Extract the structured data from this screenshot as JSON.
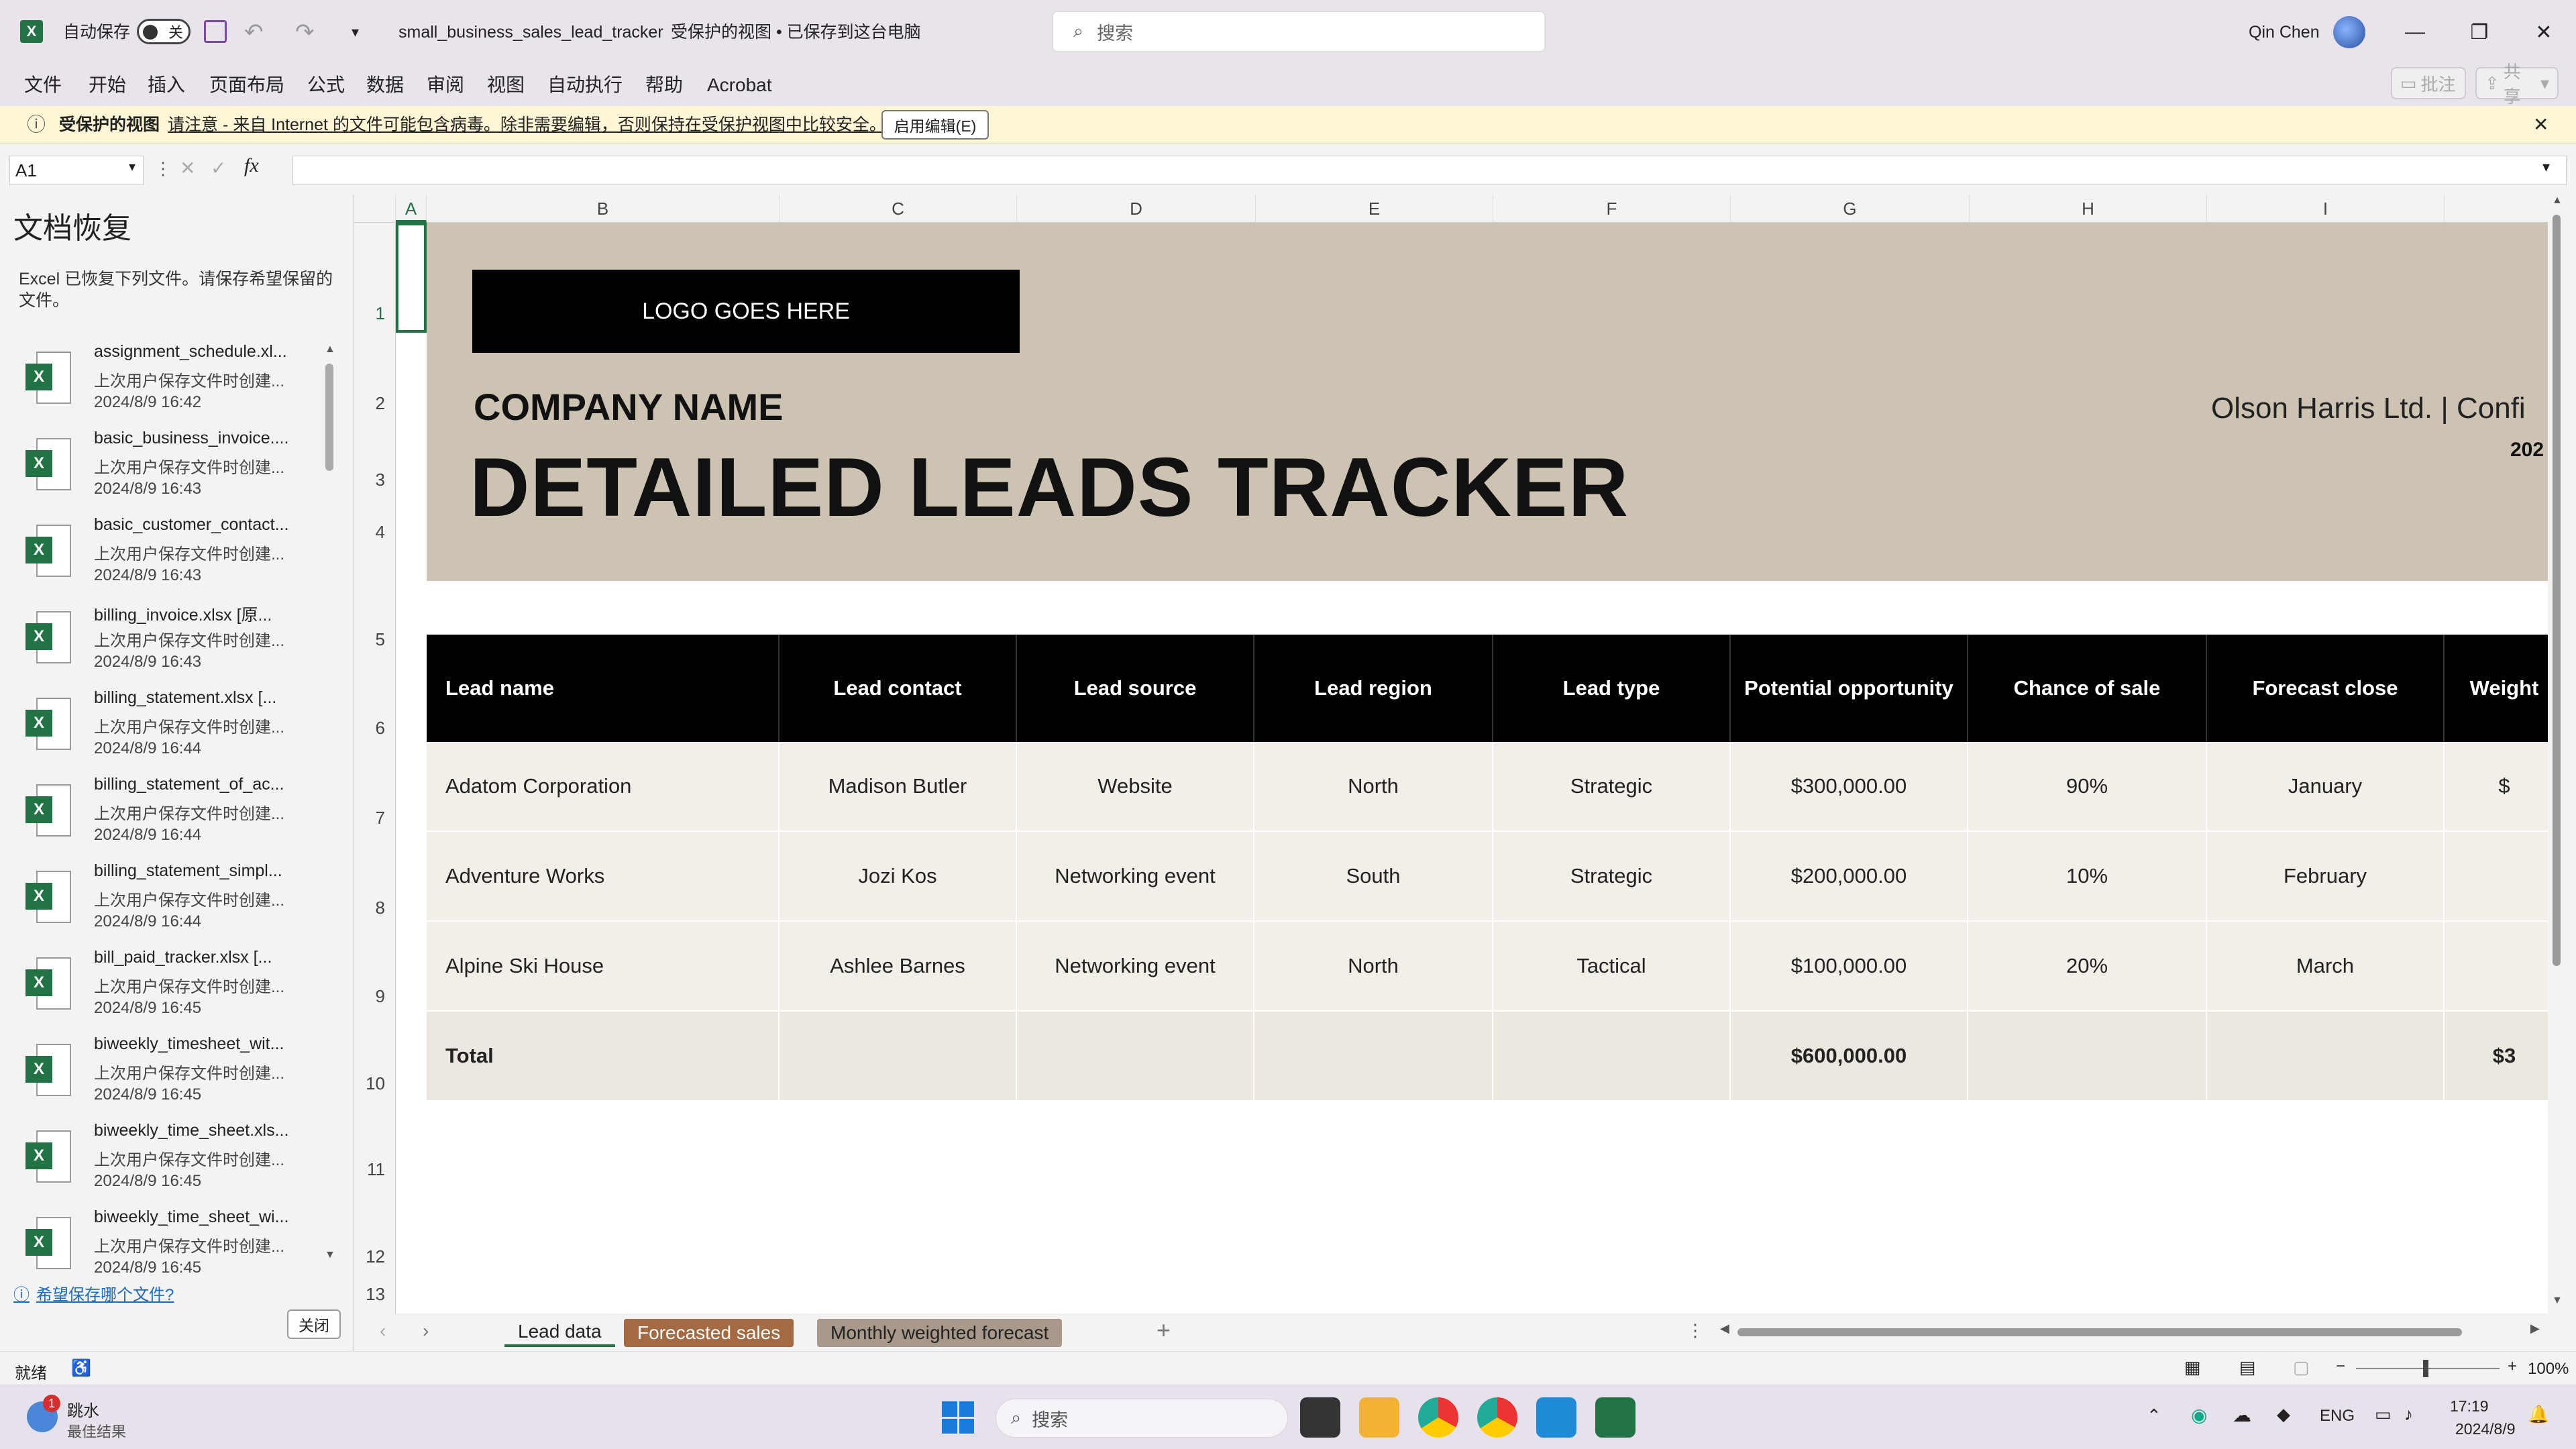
{
  "titlebar": {
    "autosave_label": "自动保存",
    "autosave_state": "关",
    "filename": "small_business_sales_lead_tracker",
    "status": "受保护的视图 • 已保存到这台电脑",
    "search_placeholder": "搜索",
    "user_name": "Qin Chen"
  },
  "menu": {
    "items": [
      "文件",
      "开始",
      "插入",
      "页面布局",
      "公式",
      "数据",
      "审阅",
      "视图",
      "自动执行",
      "帮助",
      "Acrobat"
    ],
    "comments_label": "批注",
    "share_label": "共享"
  },
  "protected_view": {
    "title": "受保护的视图",
    "message": "请注意 - 来自 Internet 的文件可能包含病毒。除非需要编辑，否则保持在受保护视图中比较安全。",
    "enable_button": "启用编辑(E)"
  },
  "formula_bar": {
    "name_box": "A1",
    "fx": "fx",
    "value": ""
  },
  "doc_recovery": {
    "title": "文档恢复",
    "description": "Excel 已恢复下列文件。请保存希望保留的文件。",
    "files": [
      {
        "name": "assignment_schedule.xl...",
        "sub": "上次用户保存文件时创建...",
        "date": "2024/8/9 16:42"
      },
      {
        "name": "basic_business_invoice....",
        "sub": "上次用户保存文件时创建...",
        "date": "2024/8/9 16:43"
      },
      {
        "name": "basic_customer_contact...",
        "sub": "上次用户保存文件时创建...",
        "date": "2024/8/9 16:43"
      },
      {
        "name": "billing_invoice.xlsx  [原...",
        "sub": "上次用户保存文件时创建...",
        "date": "2024/8/9 16:43"
      },
      {
        "name": "billing_statement.xlsx  [...",
        "sub": "上次用户保存文件时创建...",
        "date": "2024/8/9 16:44"
      },
      {
        "name": "billing_statement_of_ac...",
        "sub": "上次用户保存文件时创建...",
        "date": "2024/8/9 16:44"
      },
      {
        "name": "billing_statement_simpl...",
        "sub": "上次用户保存文件时创建...",
        "date": "2024/8/9 16:44"
      },
      {
        "name": "bill_paid_tracker.xlsx  [...",
        "sub": "上次用户保存文件时创建...",
        "date": "2024/8/9 16:45"
      },
      {
        "name": "biweekly_timesheet_wit...",
        "sub": "上次用户保存文件时创建...",
        "date": "2024/8/9 16:45"
      },
      {
        "name": "biweekly_time_sheet.xls...",
        "sub": "上次用户保存文件时创建...",
        "date": "2024/8/9 16:45"
      },
      {
        "name": "biweekly_time_sheet_wi...",
        "sub": "上次用户保存文件时创建...",
        "date": "2024/8/9 16:45"
      }
    ],
    "help_link": "希望保存哪个文件?",
    "close_button": "关闭"
  },
  "sheet": {
    "columns": [
      "A",
      "B",
      "C",
      "D",
      "E",
      "F",
      "G",
      "H",
      "I"
    ],
    "rows": [
      "1",
      "2",
      "3",
      "4",
      "5",
      "6",
      "7",
      "8",
      "9",
      "10",
      "11",
      "12",
      "13"
    ],
    "logo_text": "LOGO GOES HERE",
    "company_name": "COMPANY NAME",
    "title": "DETAILED LEADS TRACKER",
    "confidential": "Olson Harris Ltd.  |  Confi",
    "year_partial": "202",
    "table_headers": [
      "Lead name",
      "Lead contact",
      "Lead source",
      "Lead region",
      "Lead type",
      "Potential opportunity",
      "Chance of sale",
      "Forecast close",
      "Weight"
    ],
    "table_rows": [
      [
        "Adatom Corporation",
        "Madison Butler",
        "Website",
        "North",
        "Strategic",
        "$300,000.00",
        "90%",
        "January",
        "$"
      ],
      [
        "Adventure Works",
        "Jozi Kos",
        "Networking event",
        "South",
        "Strategic",
        "$200,000.00",
        "10%",
        "February",
        ""
      ],
      [
        "Alpine Ski House",
        "Ashlee Barnes",
        "Networking event",
        "North",
        "Tactical",
        "$100,000.00",
        "20%",
        "March",
        ""
      ]
    ],
    "total_row": [
      "Total",
      "",
      "",
      "",
      "",
      "$600,000.00",
      "",
      "",
      "$3"
    ]
  },
  "sheet_tabs": [
    {
      "label": "Lead data",
      "active": true,
      "color": "#ffffff"
    },
    {
      "label": "Forecasted sales",
      "active": false,
      "color": "#a46a43"
    },
    {
      "label": "Monthly weighted forecast",
      "active": false,
      "color": "#a8998a"
    }
  ],
  "status_bar": {
    "ready": "就绪",
    "zoom": "100%"
  },
  "taskbar": {
    "weather_badge": "1",
    "weather_title": "跳水",
    "weather_sub": "最佳结果",
    "search_placeholder": "搜索",
    "lang": "ENG",
    "time": "17:19",
    "date": "2024/8/9"
  },
  "colors": {
    "excel_green": "#217346",
    "banner": "#cdc3b3",
    "header_black": "#000000",
    "row_fill": "#f2efe9"
  }
}
